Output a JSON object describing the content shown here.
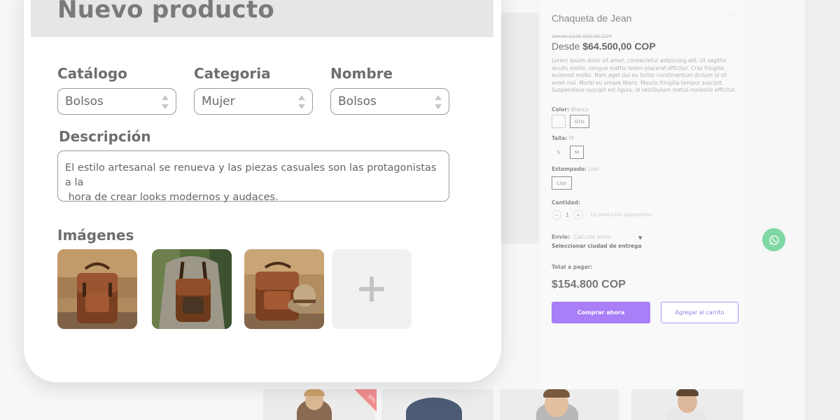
{
  "form": {
    "title": "Nuevo producto",
    "catalog": {
      "label": "Catálogo",
      "value": "Bolsos"
    },
    "category": {
      "label": "Categoria",
      "value": "Mujer"
    },
    "name": {
      "label": "Nombre",
      "value": "Bolsos"
    },
    "description": {
      "label": "Descripción",
      "line1": "El estilo artesanal se renueva y las piezas casuales son las protagonistas a la",
      "line2": " hora de crear looks modernos y audaces."
    },
    "images": {
      "label": "Imágenes",
      "add_icon": "plus-icon"
    }
  },
  "product": {
    "title": "Chaqueta de Jean",
    "old_price": "Desde $126.900,00 COP",
    "price_prefix": "Desde",
    "price": "$64.500,00 COP",
    "description": "Lorem ipsum dolor sit amet, consectetur adipiscing elit. Ut sagittis iaculis mollis, congue mattis lorem placerat efficitur. Cras fringilla euismod mollis. Nam eget dui eu tortor condimentum dictum id sit amet nisi. Morbi eu ornare libero. Mauris fringilla tempor suscipit. Suspendisse suscipit est ligula, id vestibulum metus molestie efficitur.",
    "color_label": "Color:",
    "color_value": "Blanco",
    "color_options": [
      "",
      "Gris"
    ],
    "size_label": "Talla:",
    "size_value": "M",
    "size_options": [
      "S",
      "M"
    ],
    "print_label": "Estampado:",
    "print_value": "Liso",
    "print_options": [
      "Liso"
    ],
    "quantity_label": "Cantidad:",
    "quantity_minus": "−",
    "quantity_value": "1",
    "quantity_plus": "+",
    "stock_note": "10 productos disponibles",
    "shipping_label": "Envío:",
    "shipping_value": "Calcular envío",
    "city_select": "Seleccionar ciudad de entrega",
    "total_label": "Total a pagar:",
    "total": "$154.800 COP",
    "buy_button": "Comprar ahora",
    "cart_button": "Agregar al carrito",
    "sale_badge": "20%"
  },
  "colors": {
    "accent": "#a97ef7",
    "whatsapp": "#7fd8a3"
  }
}
